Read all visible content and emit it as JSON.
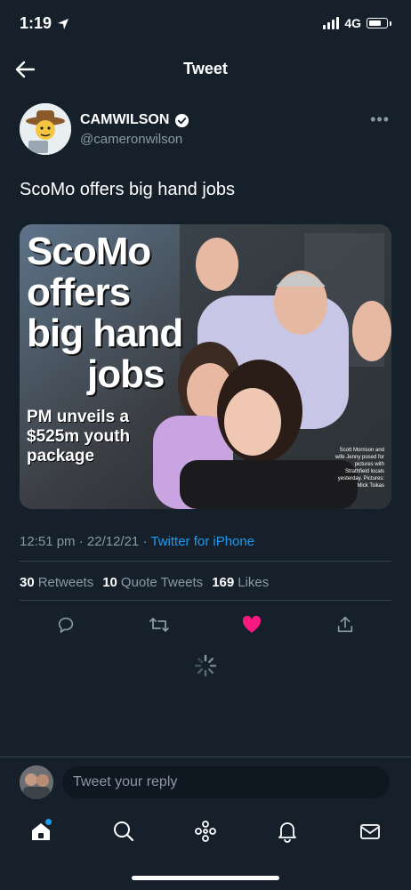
{
  "status_bar": {
    "time": "1:19",
    "network": "4G"
  },
  "header": {
    "title": "Tweet"
  },
  "tweet": {
    "author_name": "CAMWILSON",
    "handle": "@cameronwilson",
    "text": "ScoMo offers big hand jobs",
    "media": {
      "headline_lines": [
        "ScoMo",
        "offers",
        "big hand",
        "jobs"
      ],
      "subhead_lines": [
        "PM unveils a",
        "$525m youth",
        "package"
      ],
      "caption": "Scott Morrison and wife Jenny posed for pictures with Strathfield locals yesterday. Pictures: Mick Tsikas"
    },
    "time": "12:51 pm",
    "date": "22/12/21",
    "separator": "·",
    "source": "Twitter for iPhone",
    "stats": {
      "retweets_count": "30",
      "retweets_label": "Retweets",
      "quotes_count": "10",
      "quotes_label": "Quote Tweets",
      "likes_count": "169",
      "likes_label": "Likes"
    }
  },
  "reply": {
    "placeholder": "Tweet your reply"
  },
  "colors": {
    "background": "#15202b",
    "accent": "#1d9bf0",
    "like": "#f91880",
    "muted": "#8b98a5"
  },
  "icons": [
    "location-arrow-icon",
    "signal-icon",
    "battery-icon",
    "back-arrow-icon",
    "verified-badge-icon",
    "more-icon",
    "reply-icon",
    "retweet-icon",
    "like-icon",
    "share-icon",
    "loading-spinner-icon",
    "home-icon",
    "search-icon",
    "spaces-icon",
    "notifications-icon",
    "messages-icon"
  ]
}
